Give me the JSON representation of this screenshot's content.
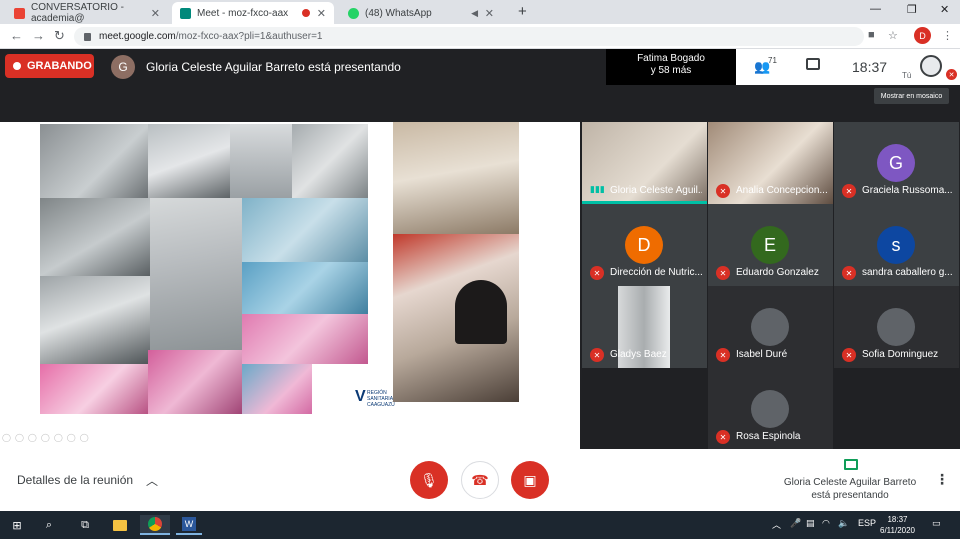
{
  "browser": {
    "tabs": [
      {
        "label": "CONVERSATORIO - academia@",
        "favicon": "gmail-icon",
        "active": false
      },
      {
        "label": "Meet - moz-fxco-aax",
        "favicon": "meet-icon",
        "active": true
      },
      {
        "label": "(48) WhatsApp",
        "favicon": "whatsapp-icon",
        "active": false
      }
    ],
    "url_host": "meet.google.com",
    "url_path": "/moz-fxco-aax?pli=1&authuser=1",
    "profile_initial": "D"
  },
  "meet": {
    "recording_label": "GRABANDO",
    "presenter_initial": "G",
    "presenting_title": "Gloria Celeste Aguilar Barreto está presentando",
    "others_line1": "Fatima Bogado",
    "others_line2": "y 58 más",
    "participant_count": "71",
    "clock": "18:37",
    "self_label": "Tú",
    "tile_button": "Mostrar en mosaico",
    "slide_logo_text": "REGIÓN SANITARIA CAAGUAZÚ"
  },
  "participants": [
    {
      "name": "Gloria Celeste Aguil...",
      "type": "video",
      "status": "speaking"
    },
    {
      "name": "Analia Concepcion...",
      "type": "video",
      "status": "muted"
    },
    {
      "name": "Graciela Russoma...",
      "type": "avatar",
      "initial": "G",
      "color": "#7e57c2",
      "status": "muted"
    },
    {
      "name": "Dirección de Nutric...",
      "type": "avatar",
      "initial": "D",
      "color": "#ef6c00",
      "status": "muted"
    },
    {
      "name": "Eduardo Gonzalez",
      "type": "avatar",
      "initial": "E",
      "color": "#33691e",
      "status": "muted"
    },
    {
      "name": "sandra caballero g...",
      "type": "avatar",
      "initial": "s",
      "color": "#0d47a1",
      "status": "muted"
    },
    {
      "name": "Gladys Baez",
      "type": "video",
      "status": "muted"
    },
    {
      "name": "Isabel Duré",
      "type": "avatar",
      "initial": "",
      "color": "#5f6368",
      "status": "muted"
    },
    {
      "name": "Sofia Dominguez",
      "type": "avatar",
      "initial": "",
      "color": "#5f6368",
      "status": "muted"
    },
    {
      "name": "Rosa Espinola",
      "type": "avatar",
      "initial": "",
      "color": "#5f6368",
      "status": "muted"
    }
  ],
  "callbar": {
    "details_label": "Detalles de la reunión",
    "presenting_label_line1": "Gloria Celeste Aguilar Barreto",
    "presenting_label_line2": "está presentando"
  },
  "taskbar": {
    "language": "ESP",
    "time": "18:37",
    "date": "6/11/2020"
  },
  "colors": {
    "accent_red": "#d93025",
    "meet_dark": "#202124",
    "speaking_teal": "#00bfa5"
  }
}
